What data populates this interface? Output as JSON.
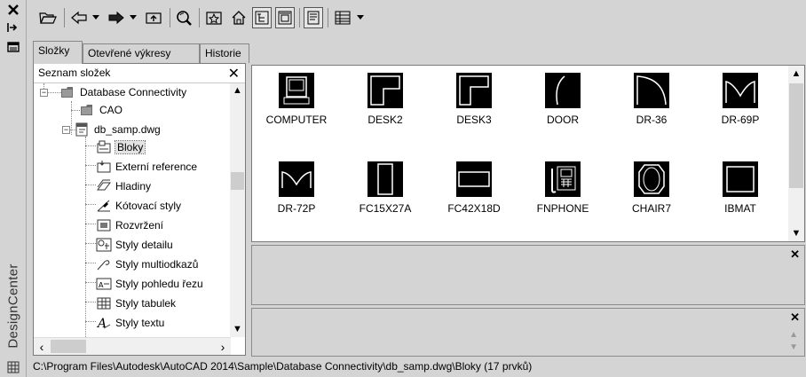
{
  "window": {
    "title": "DesignCenter"
  },
  "tabs": [
    {
      "label": "Složky"
    },
    {
      "label": "Otevřené výkresy"
    },
    {
      "label": "Historie"
    }
  ],
  "tree": {
    "header": "Seznam složek",
    "nodes": [
      {
        "label": "Database Connectivity",
        "icon": "folder-icon"
      },
      {
        "label": "CAO",
        "icon": "folder-icon"
      },
      {
        "label": "db_samp.dwg",
        "icon": "drawing-file-icon"
      },
      {
        "label": "Bloky",
        "icon": "blocks-icon",
        "selected": true
      },
      {
        "label": "Externí reference",
        "icon": "xref-icon"
      },
      {
        "label": "Hladiny",
        "icon": "layers-icon"
      },
      {
        "label": "Kótovací styly",
        "icon": "dimstyle-icon"
      },
      {
        "label": "Rozvržení",
        "icon": "layout-icon"
      },
      {
        "label": "Styly detailu",
        "icon": "detail-style-icon"
      },
      {
        "label": "Styly multiodkazů",
        "icon": "mleader-style-icon"
      },
      {
        "label": "Styly pohledu řezu",
        "icon": "section-style-icon"
      },
      {
        "label": "Styly tabulek",
        "icon": "table-style-icon"
      },
      {
        "label": "Styly textu",
        "icon": "text-style-icon"
      }
    ]
  },
  "blocks": [
    {
      "name": "COMPUTER"
    },
    {
      "name": "DESK2"
    },
    {
      "name": "DESK3"
    },
    {
      "name": "DOOR"
    },
    {
      "name": "DR-36"
    },
    {
      "name": "DR-69P"
    },
    {
      "name": "DR-72P"
    },
    {
      "name": "FC15X27A"
    },
    {
      "name": "FC42X18D"
    },
    {
      "name": "FNPHONE"
    },
    {
      "name": "CHAIR7"
    },
    {
      "name": "IBMAT"
    }
  ],
  "status": {
    "path": "C:\\Program Files\\Autodesk\\AutoCAD 2014\\Sample\\Database Connectivity\\db_samp.dwg\\Bloky (17 prvků)"
  }
}
